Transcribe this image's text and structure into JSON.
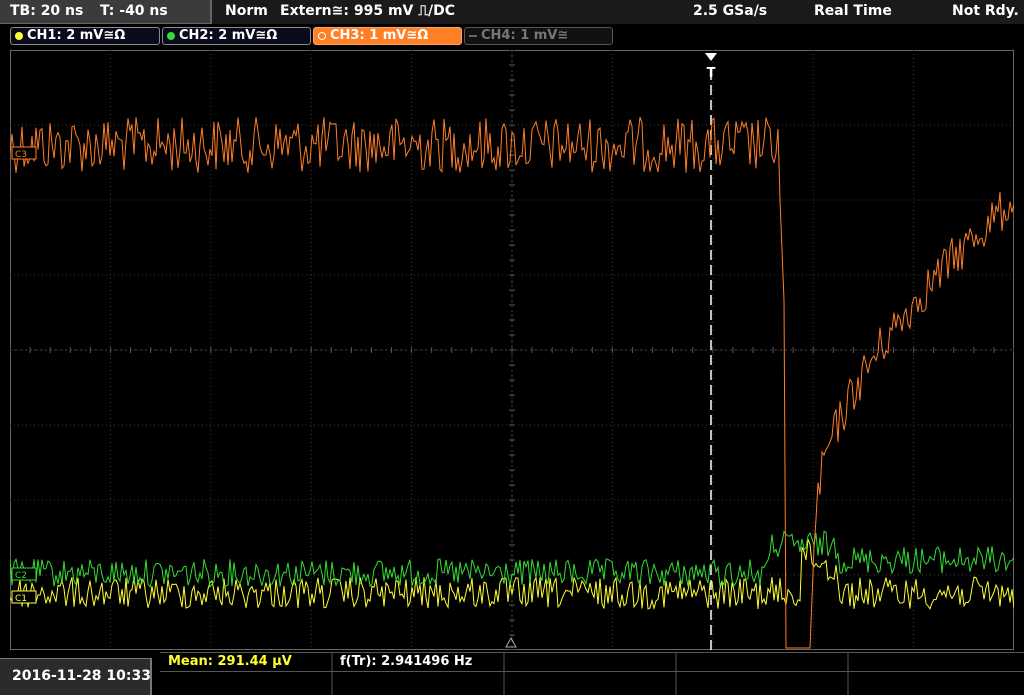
{
  "top_bar": {
    "timebase": "TB: 20 ns",
    "trigger_time": "T: -40 ns",
    "trigger_mode": "Norm",
    "trigger_source": "Extern≅: 995 mV ⎍/DC",
    "sample_rate": "2.5 GSa/s",
    "acq_mode": "Real Time",
    "status": "Not Rdy."
  },
  "channels": [
    {
      "label": "CH1: 2 mV≅Ω",
      "color": "#ffff33",
      "state": "on"
    },
    {
      "label": "CH2: 2 mV≅Ω",
      "color": "#33dd33",
      "state": "on"
    },
    {
      "label": "CH3: 1 mV≅Ω",
      "color": "#ff7f27",
      "state": "active"
    },
    {
      "label": "CH4: 1 mV≅",
      "color": "#666666",
      "state": "off"
    }
  ],
  "markers": {
    "trigger_marker": "T",
    "ch3_marker": "C3",
    "ch2_marker": "C2",
    "ch1_marker": "C1"
  },
  "bottom_bar": {
    "datetime": "2016-11-28 10:33",
    "measurement_1": "Mean: 291.44 µV",
    "measurement_2": "f(Tr): 2.941496 Hz"
  }
}
